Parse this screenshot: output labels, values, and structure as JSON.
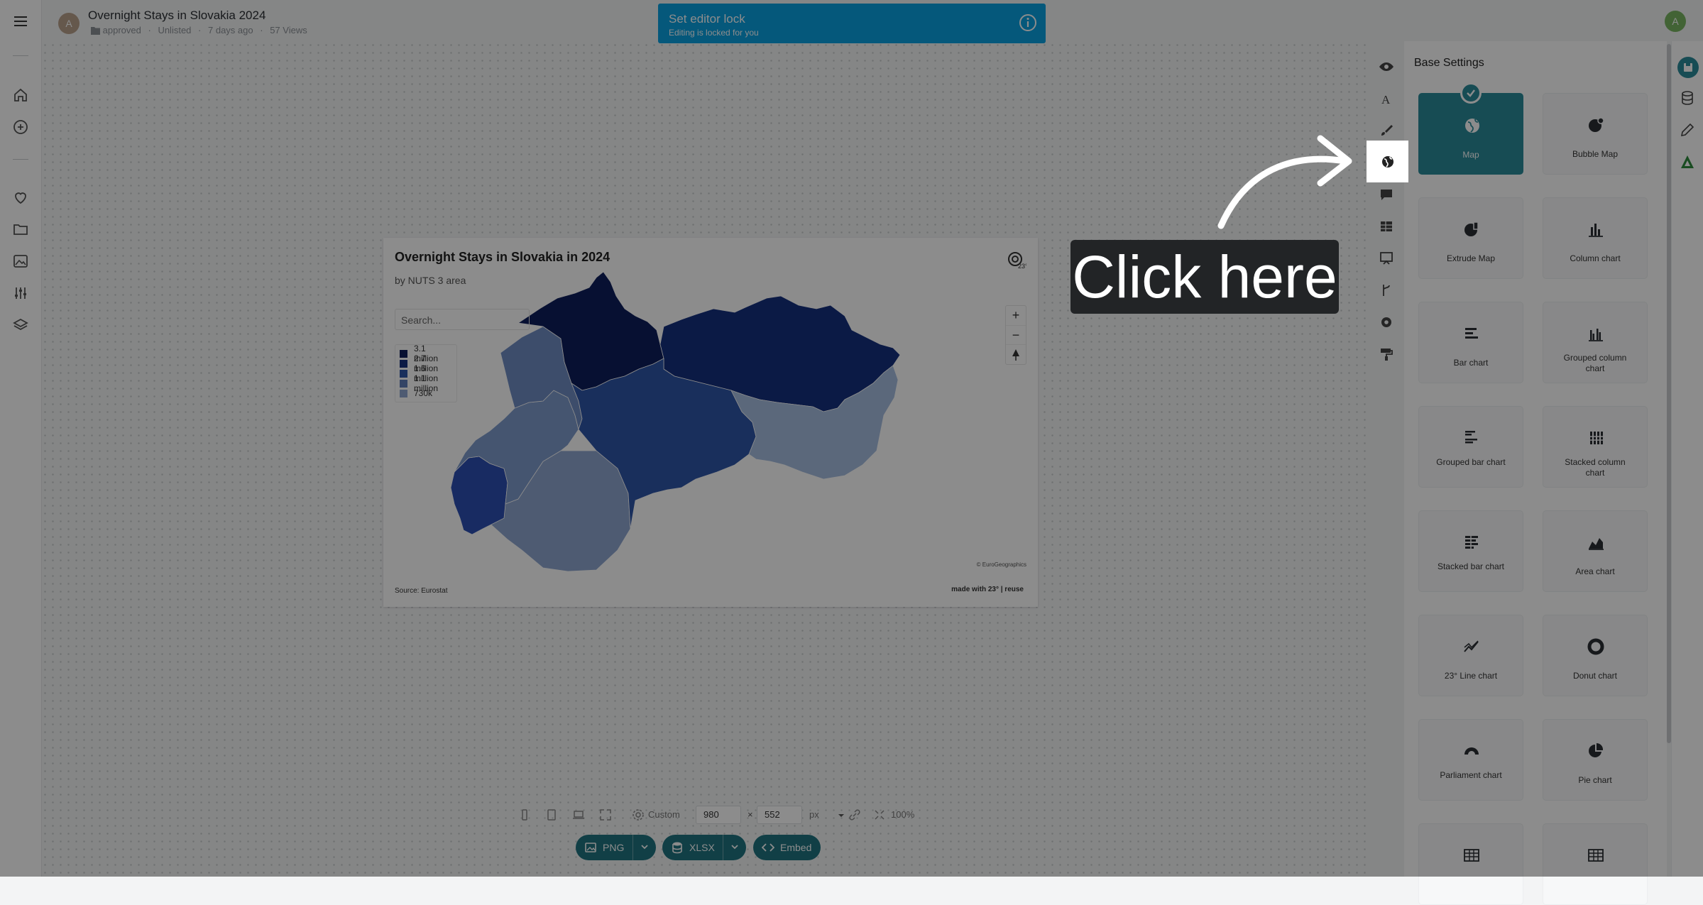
{
  "header": {
    "avatar_left": "A",
    "title": "Overnight Stays in Slovakia 2024",
    "status": "approved",
    "visibility": "Unlisted",
    "age": "7 days ago",
    "views": "57 Views",
    "avatar_right": "A"
  },
  "lock_banner": {
    "title": "Set editor lock",
    "subtitle": "Editing is locked for you"
  },
  "chart": {
    "title": "Overnight Stays in Slovakia in 2024",
    "subtitle": "by NUTS 3 area",
    "search_placeholder": "Search...",
    "source": "Source: Eurostat",
    "attribution": "© EuroGeographics",
    "made_with": "made with 23° | reuse",
    "zoom_in": "+",
    "zoom_out": "−"
  },
  "chart_data": {
    "type": "choropleth-map",
    "title": "Overnight Stays in Slovakia in 2024",
    "subtitle": "by NUTS 3 area",
    "legend": [
      {
        "label": "3.1 million",
        "color": "#0d1e5c"
      },
      {
        "label": "2.7 million",
        "color": "#14307f"
      },
      {
        "label": "1.6 million",
        "color": "#2f56a8"
      },
      {
        "label": "1.1 million",
        "color": "#5f7fba"
      },
      {
        "label": "730k",
        "color": "#8fa6d0"
      }
    ],
    "regions": [
      {
        "id": "west-lower",
        "color": "#8fa6d0"
      },
      {
        "id": "west-bratislava",
        "color": "#2c4fb3"
      },
      {
        "id": "west-upper",
        "color": "#7f9bcc"
      },
      {
        "id": "north-mid",
        "color": "#0d1e5c"
      },
      {
        "id": "north-east",
        "color": "#14307f"
      },
      {
        "id": "central",
        "color": "#2f56a8"
      },
      {
        "id": "south-central",
        "color": "#95aed4"
      },
      {
        "id": "east-lower",
        "color": "#a7bde0"
      }
    ]
  },
  "sizebar": {
    "preset": "Custom",
    "width": "980",
    "times": "×",
    "height": "552",
    "unit": "px",
    "zoom": "100%"
  },
  "export": {
    "png": "PNG",
    "xlsx": "XLSX",
    "embed": "Embed"
  },
  "panel": {
    "title": "Base Settings",
    "tiles": [
      {
        "label": "Map",
        "icon": "globe-icon"
      },
      {
        "label": "Bubble Map",
        "icon": "bubble-map-icon"
      },
      {
        "label": "Extrude Map",
        "icon": "extrude-map-icon"
      },
      {
        "label": "Column chart",
        "icon": "column-chart-icon"
      },
      {
        "label": "Bar chart",
        "icon": "bar-chart-icon"
      },
      {
        "label": "Grouped column chart",
        "icon": "grouped-column-chart-icon"
      },
      {
        "label": "Grouped bar chart",
        "icon": "grouped-bar-chart-icon"
      },
      {
        "label": "Stacked column chart",
        "icon": "stacked-column-chart-icon"
      },
      {
        "label": "Stacked bar chart",
        "icon": "stacked-bar-chart-icon"
      },
      {
        "label": "Area chart",
        "icon": "area-chart-icon"
      },
      {
        "label": "23° Line chart",
        "icon": "line-chart-icon"
      },
      {
        "label": "Donut chart",
        "icon": "donut-chart-icon"
      },
      {
        "label": "Parliament chart",
        "icon": "parliament-chart-icon"
      },
      {
        "label": "Pie chart",
        "icon": "pie-chart-icon"
      }
    ]
  },
  "callout": {
    "text": "Click here"
  },
  "colors": {
    "accent": "#2a8b9a",
    "banner": "#0aa0e0",
    "export_pill": "#1f7480"
  }
}
